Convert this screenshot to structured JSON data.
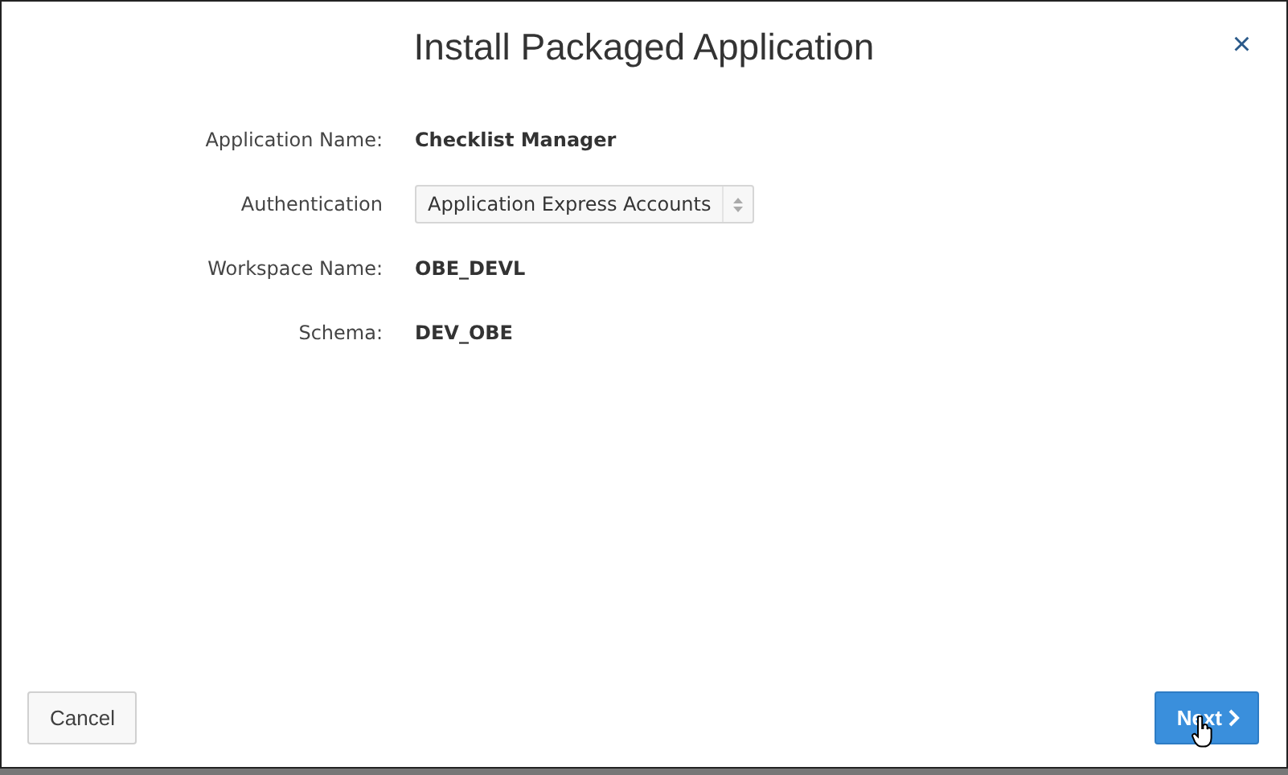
{
  "dialog": {
    "title": "Install Packaged Application",
    "close": "×"
  },
  "fields": [
    {
      "kind": "text",
      "label": "Application Name:",
      "value": "Checklist Manager"
    },
    {
      "kind": "select",
      "label": "Authentication",
      "value": "Application Express Accounts"
    },
    {
      "kind": "text",
      "label": "Workspace Name:",
      "value": "OBE_DEVL"
    },
    {
      "kind": "text",
      "label": "Schema:",
      "value": "DEV_OBE"
    }
  ],
  "buttons": [
    {
      "kind": "secondary",
      "label": "Cancel"
    },
    {
      "kind": "primary",
      "label": "Next"
    }
  ]
}
